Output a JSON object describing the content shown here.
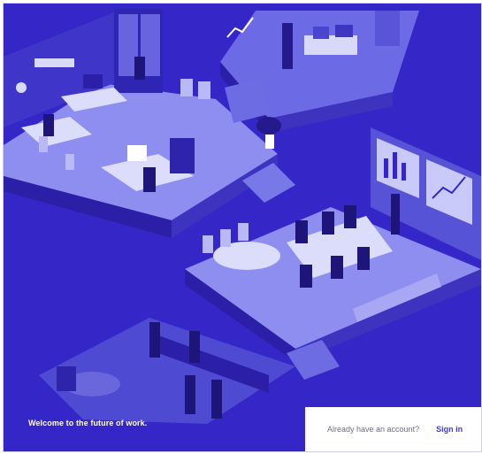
{
  "hero": {
    "tagline": "Welcome to the future of work."
  },
  "auth": {
    "prompt": "Already have an account?",
    "signin_label": "Sign in"
  },
  "colors": {
    "background": "#3526c8",
    "floor_top": "#8e8ef0",
    "floor_side": "#2a1fa6",
    "panel": "#ffffff",
    "link": "#3c3ddb"
  }
}
